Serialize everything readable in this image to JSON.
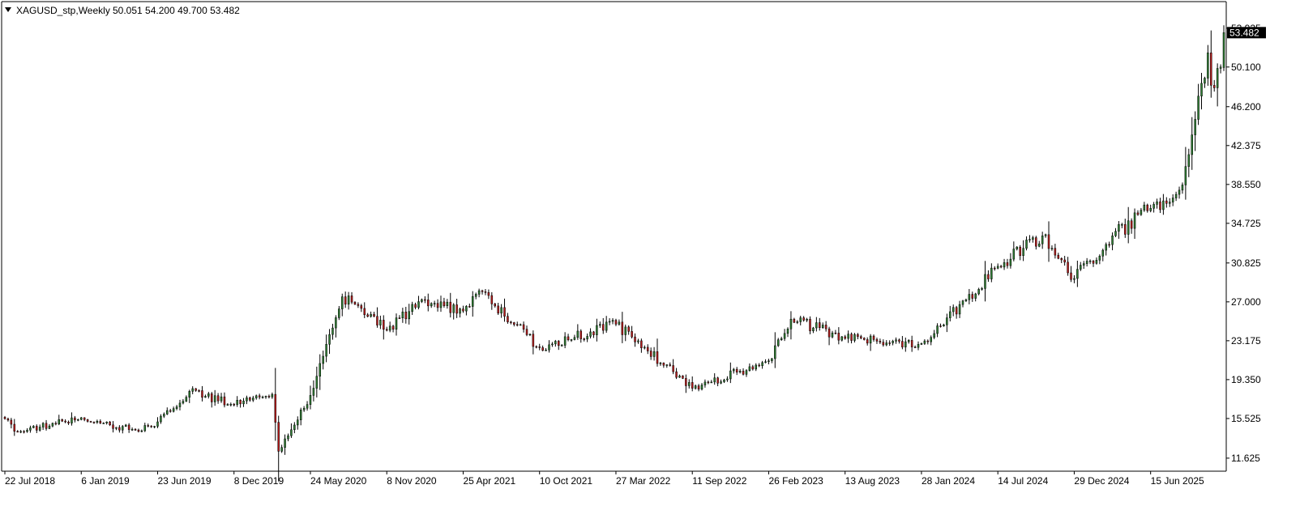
{
  "header": {
    "dropdown_icon": "triangle-down-icon",
    "symbol": "XAGUSD_stp,Weekly",
    "ohlc": "50.051 54.200 49.700 53.482"
  },
  "colors": {
    "bull": "#2e7d32",
    "bear": "#b71c1c",
    "wick": "#000000",
    "axis": "#000000",
    "price_badge_bg": "#000000",
    "price_badge_fg": "#ffffff"
  },
  "price_axis": {
    "ticks": [
      "53.925",
      "50.100",
      "46.200",
      "42.375",
      "38.550",
      "34.725",
      "30.825",
      "27.000",
      "23.175",
      "19.350",
      "15.525",
      "11.625"
    ],
    "current_price": "53.482"
  },
  "time_axis": {
    "labels": [
      "22 Jul 2018",
      "6 Jan 2019",
      "23 Jun 2019",
      "8 Dec 2019",
      "24 May 2020",
      "8 Nov 2020",
      "25 Apr 2021",
      "10 Oct 2021",
      "27 Mar 2022",
      "11 Sep 2022",
      "26 Feb 2023",
      "13 Aug 2023",
      "28 Jan 2024",
      "14 Jul 2024",
      "29 Dec 2024",
      "15 Jun 2025"
    ]
  },
  "chart_data": {
    "type": "candlestick",
    "title": "XAGUSD_stp,Weekly",
    "series": [
      {
        "name": "XAGUSD_stp",
        "ohlc_last": {
          "open": 50.051,
          "high": 54.2,
          "low": 49.7,
          "close": 53.482
        }
      }
    ],
    "ylim": [
      10.9,
      55.1
    ],
    "grid": false,
    "waypoints": [
      [
        "22 Jul 2018",
        15.5
      ],
      [
        "19 Aug 2018",
        14.2
      ],
      [
        "6 Jan 2019",
        15.6
      ],
      [
        "10 Mar 2019",
        14.9
      ],
      [
        "5 May 2019",
        14.4
      ],
      [
        "23 Jun 2019",
        15.2
      ],
      [
        "1 Sep 2019",
        18.2
      ],
      [
        "8 Dec 2019",
        16.9
      ],
      [
        "1 Mar 2020",
        17.9
      ],
      [
        "15 Mar 2020",
        12.3
      ],
      [
        "24 May 2020",
        17.8
      ],
      [
        "2 Aug 2020",
        27.5
      ],
      [
        "8 Nov 2020",
        24.2
      ],
      [
        "31 Jan 2021",
        27.2
      ],
      [
        "25 Apr 2021",
        26.1
      ],
      [
        "30 May 2021",
        28.1
      ],
      [
        "10 Oct 2021",
        22.5
      ],
      [
        "27 Mar 2022",
        24.8
      ],
      [
        "11 Sep 2022",
        18.5
      ],
      [
        "26 Feb 2023",
        21.2
      ],
      [
        "16 Apr 2023",
        25.3
      ],
      [
        "13 Aug 2023",
        23.4
      ],
      [
        "28 Jan 2024",
        22.9
      ],
      [
        "14 Jul 2024",
        30.5
      ],
      [
        "20 Oct 2024",
        33.5
      ],
      [
        "29 Dec 2024",
        29.3
      ],
      [
        "23 Mar 2025",
        33.5
      ],
      [
        "15 Jun 2025",
        36.2
      ],
      [
        "24 Aug 2025",
        38.5
      ],
      [
        "5 Oct 2025",
        48.5
      ],
      [
        "19 Oct 2025",
        51.5
      ],
      [
        "26 Oct 2025",
        48.3
      ],
      [
        "16 Nov 2025",
        50.1
      ],
      [
        "23 Nov 2025",
        53.482
      ]
    ]
  }
}
